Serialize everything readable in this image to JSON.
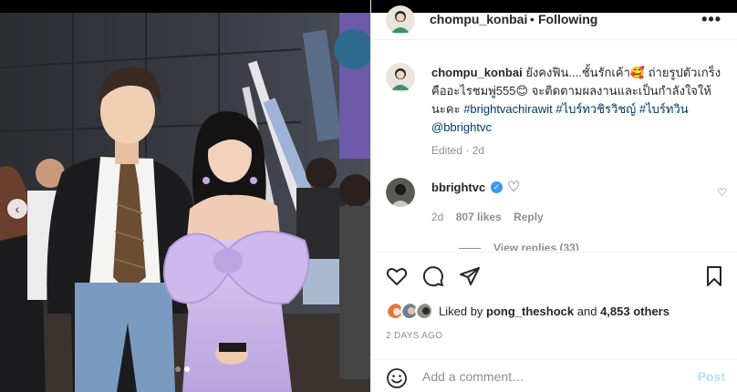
{
  "post": {
    "author": "chompu_konbai",
    "follow_state": "Following",
    "separator": "•",
    "more_icon": "•••"
  },
  "caption": {
    "username": "chompu_konbai",
    "text_part1": "ยังคงฟิน....ชั้นรักเค้า",
    "emoji1": "🥰",
    "text_part2": "ถ่ายรูปตัวเกร็งคืออะไรชมพู่555",
    "emoji2": "😊",
    "text_part3": "จะติดตามผลงานและเป็นกำลังใจให้นะคะ",
    "hashtag1": "#brightvachirawit",
    "hashtag2": "#ไบร์ทวชิรวิชญ์",
    "hashtag3": "#ไบร์ทวิน",
    "mention": "@bbrightvc",
    "edited": "Edited · 2d"
  },
  "comment": {
    "username": "bbrightvc",
    "verified_icon": "✓",
    "heart_icon": "♡",
    "time": "2d",
    "likes": "807 likes",
    "reply": "Reply",
    "view_replies": "View replies (33)"
  },
  "liked_by": {
    "prefix": "Liked by",
    "user": "pong_theshock",
    "and": "and",
    "others": "4,853 others"
  },
  "timestamp": "2 DAYS AGO",
  "add_comment": {
    "placeholder": "Add a comment…",
    "post_label": "Post"
  },
  "carousel": {
    "prev_icon": "‹",
    "dots": 2,
    "active_dot": 1
  },
  "colors": {
    "link": "#00376b",
    "verified": "#3897f0",
    "post_disabled": "#b2dffc",
    "muted": "#8e8e8e",
    "dress": "#c9b6e6"
  }
}
